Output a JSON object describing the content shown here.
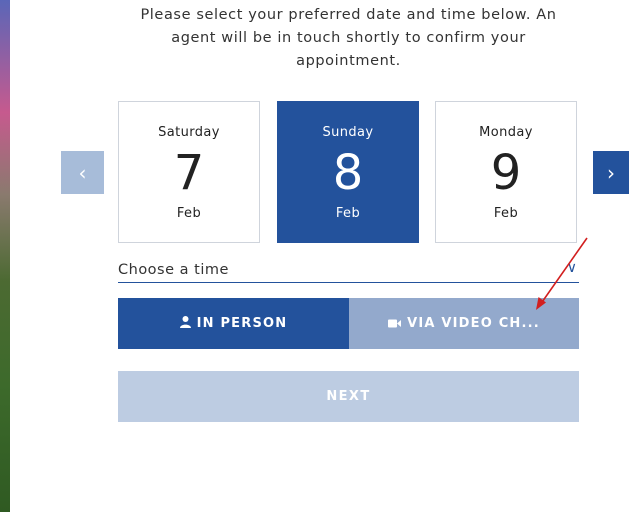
{
  "intro_text": "Please select your preferred date and time below. An agent will be in touch shortly to confirm your appointment.",
  "nav": {
    "prev_icon": "‹",
    "next_icon": "›"
  },
  "dates": [
    {
      "dow": "Saturday",
      "day": "7",
      "mon": "Feb",
      "selected": false
    },
    {
      "dow": "Sunday",
      "day": "8",
      "mon": "Feb",
      "selected": true
    },
    {
      "dow": "Monday",
      "day": "9",
      "mon": "Feb",
      "selected": false
    }
  ],
  "time_select": {
    "label": "Choose a time",
    "chevron": "∨"
  },
  "appointment_type": {
    "in_person": "IN PERSON",
    "video": "VIA VIDEO CH...",
    "in_person_icon": "person-icon",
    "video_icon": "video-camera-icon"
  },
  "next_label": "NEXT",
  "colors": {
    "primary": "#23529c",
    "light": "#93a9cc",
    "disabled": "#bdcce2",
    "annotation": "#d21f1f"
  }
}
